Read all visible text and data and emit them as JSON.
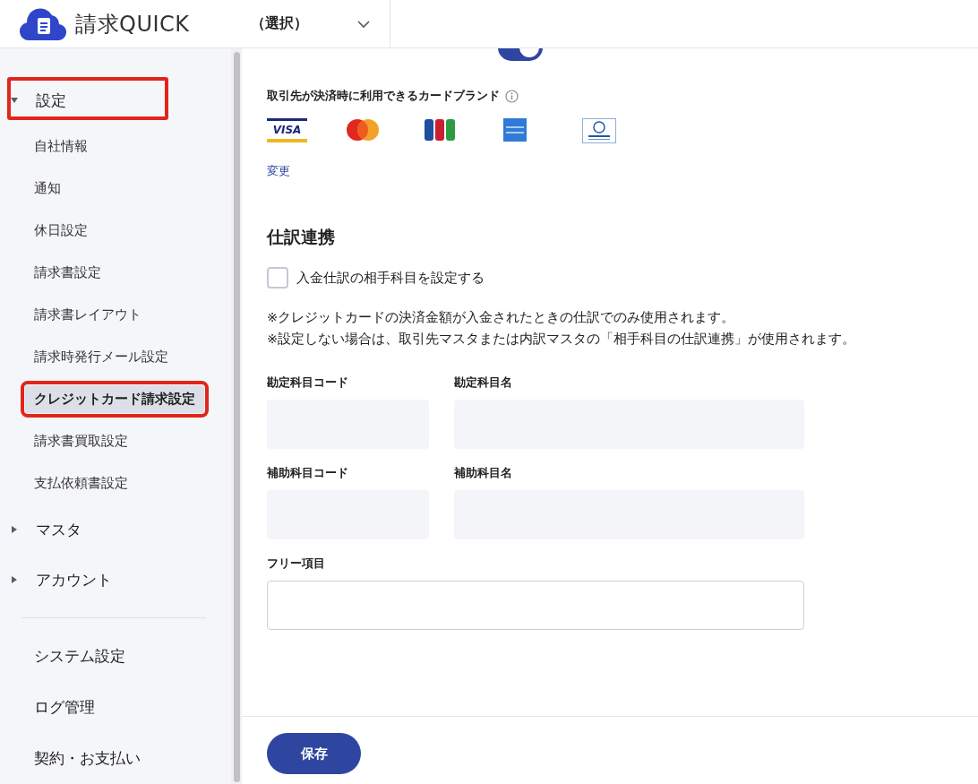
{
  "header": {
    "logo_text": "請求QUICK",
    "selector": "（選択）"
  },
  "sidebar": {
    "items": [
      {
        "label": "設定",
        "kind": "group",
        "expanded": true,
        "annotated": true,
        "children": [
          {
            "label": "自社情報",
            "selected": false,
            "annotated": false
          },
          {
            "label": "通知",
            "selected": false,
            "annotated": false
          },
          {
            "label": "休日設定",
            "selected": false,
            "annotated": false
          },
          {
            "label": "請求書設定",
            "selected": false,
            "annotated": false
          },
          {
            "label": "請求書レイアウト",
            "selected": false,
            "annotated": false
          },
          {
            "label": "請求時発行メール設定",
            "selected": false,
            "annotated": false
          },
          {
            "label": "クレジットカード請求設定",
            "selected": true,
            "annotated": true
          },
          {
            "label": "請求書買取設定",
            "selected": false,
            "annotated": false
          },
          {
            "label": "支払依頼書設定",
            "selected": false,
            "annotated": false
          }
        ]
      },
      {
        "label": "マスタ",
        "kind": "group",
        "expanded": false,
        "annotated": false
      },
      {
        "label": "アカウント",
        "kind": "group",
        "expanded": false,
        "annotated": false
      },
      {
        "kind": "divider"
      },
      {
        "label": "システム設定",
        "kind": "link"
      },
      {
        "label": "ログ管理",
        "kind": "link"
      },
      {
        "label": "契約・お支払い",
        "kind": "link"
      }
    ]
  },
  "top_toggle": {
    "on": true
  },
  "card_brands": {
    "label": "取引先が決済時に利用できるカードブランド",
    "brands": [
      {
        "kind": "visa",
        "label": "VISA"
      },
      {
        "kind": "mastercard"
      },
      {
        "kind": "jcb"
      },
      {
        "kind": "amex"
      },
      {
        "kind": "diners"
      }
    ],
    "change_link": "変更"
  },
  "journal": {
    "title": "仕訳連携",
    "checkbox": {
      "label": "入金仕訳の相手科目を設定する",
      "checked": false
    },
    "notes": [
      "※クレジットカードの決済金額が入金されたときの仕訳でのみ使用されます。",
      "※設定しない場合は、取引先マスタまたは内訳マスタの「相手科目の仕訳連携」が使用されます。"
    ],
    "fields": [
      {
        "label": "勘定科目コード",
        "kind": "short"
      },
      {
        "label": "勘定科目名",
        "kind": "long"
      },
      {
        "label": "補助科目コード",
        "kind": "short"
      },
      {
        "label": "補助科目名",
        "kind": "long"
      },
      {
        "label": "フリー項目",
        "kind": "free"
      }
    ]
  },
  "footer": {
    "save_button": "保存"
  }
}
